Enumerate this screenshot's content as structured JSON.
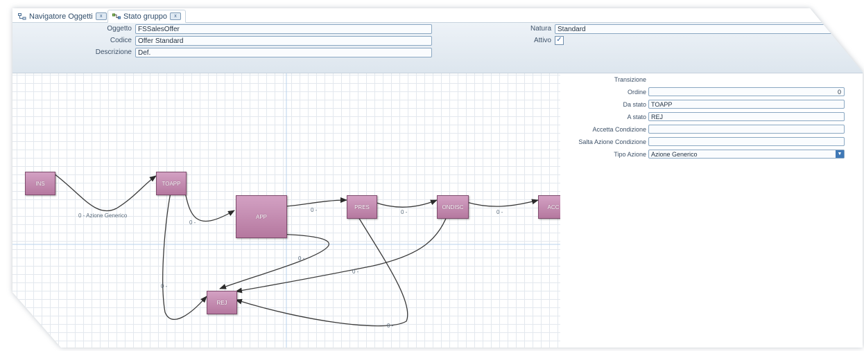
{
  "tabs": [
    {
      "label": "Navigatore Oggetti",
      "icon": "tree-icon",
      "close": "x"
    },
    {
      "label": "Stato gruppo",
      "icon": "workflow-icon",
      "close": "x"
    }
  ],
  "form": {
    "oggetto_label": "Oggetto",
    "oggetto_value": "FSSalesOffer",
    "codice_label": "Codice",
    "codice_value": "Offer Standard",
    "descrizione_label": "Descrizione",
    "descrizione_value": "Def.",
    "natura_label": "Natura",
    "natura_value": "Standard",
    "attivo_label": "Attivo",
    "attivo_checked": true,
    "check_glyph": "✓"
  },
  "diagram": {
    "nodes": [
      {
        "id": "INS",
        "label": "INS"
      },
      {
        "id": "TOAPP",
        "label": "TOAPP"
      },
      {
        "id": "APP",
        "label": "APP"
      },
      {
        "id": "PRES",
        "label": "PRES"
      },
      {
        "id": "ONDISC",
        "label": "ONDISC"
      },
      {
        "id": "ACC",
        "label": "ACC"
      },
      {
        "id": "REJ",
        "label": "REJ"
      }
    ],
    "edge_labels": [
      {
        "edge": "INS-TOAPP",
        "text": "0 - Azione Generico"
      },
      {
        "edge": "TOAPP-APP",
        "text": "0 -"
      },
      {
        "edge": "APP-PRES",
        "text": "0 -"
      },
      {
        "edge": "PRES-ONDISC",
        "text": "0 -"
      },
      {
        "edge": "ONDISC-ACC",
        "text": "0 -"
      },
      {
        "edge": "APP-REJ",
        "text": "0 -"
      },
      {
        "edge": "ONDISC-REJ",
        "text": "0 -"
      },
      {
        "edge": "TOAPP-REJ",
        "text": "0 -"
      },
      {
        "edge": "PRES-REJ",
        "text": "0 -"
      }
    ],
    "colors": {
      "node_fill": "#c48db2",
      "grid": "#e3e8ee",
      "edge": "#3a3a3a"
    }
  },
  "properties": {
    "header": "Transizione",
    "ordine_label": "Ordine",
    "ordine_value": "0",
    "da_stato_label": "Da stato",
    "da_stato_value": "TOAPP",
    "a_stato_label": "A stato",
    "a_stato_value": "REJ",
    "accetta_label": "Accetta Condizione",
    "accetta_value": "",
    "salta_label": "Salta Azione Condizione",
    "salta_value": "",
    "tipo_label": "Tipo Azione",
    "tipo_value": "Azione Generico",
    "dropdown_glyph": "▼"
  }
}
